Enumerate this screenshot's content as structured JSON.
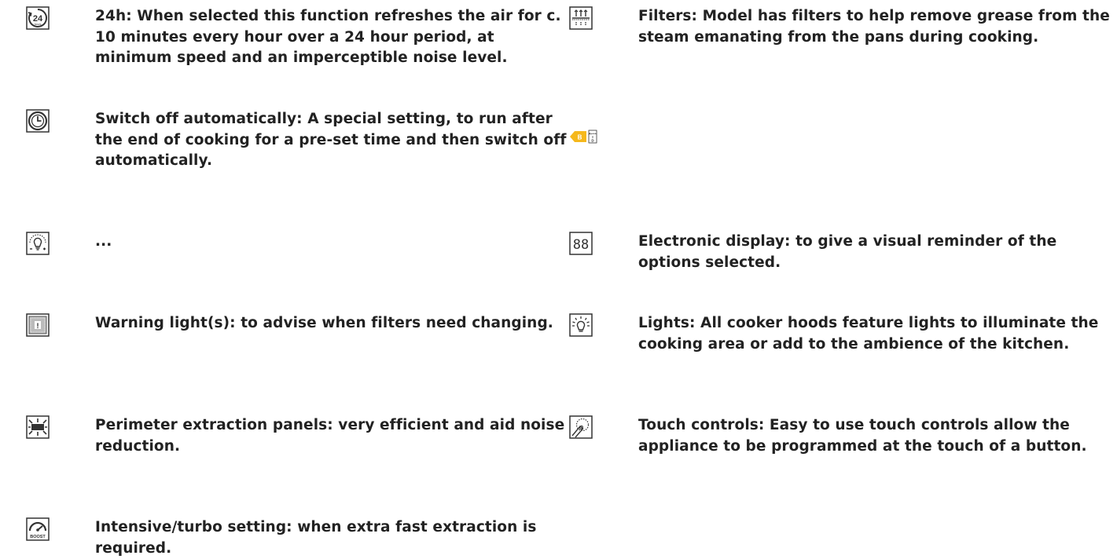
{
  "features": {
    "left": [
      {
        "icon": "24-hours-icon",
        "text": "24h: When selected this function refreshes the air for c. 10 minutes every hour over a 24 hour period, at minimum speed and an imperceptible noise level."
      },
      {
        "icon": "clock-icon",
        "text": "Switch off automatically: A special setting, to run after the end of cooking for a pre-set time and then switch off automatically."
      },
      {
        "icon": "dimmable-light-icon",
        "text": "..."
      },
      {
        "icon": "filter-warning-icon",
        "text": "Warning light(s): to advise when filters need changing."
      },
      {
        "icon": "perimeter-extraction-icon",
        "text": "Perimeter extraction panels: very efficient and aid noise reduction."
      },
      {
        "icon": "boost-icon",
        "icon_label": "BOOST",
        "text": "Intensive/turbo setting: when extra fast extraction is required."
      }
    ],
    "right": [
      {
        "icon": "grease-filter-icon",
        "text": "Filters: Model has filters to help remove grease from the steam emanating from the pans during cooking."
      },
      {
        "icon": "energy-class-icon",
        "icon_label": "B",
        "icon_scale": [
          "A+++",
          "D"
        ],
        "text": ""
      },
      {
        "icon": "digital-display-icon",
        "icon_label": "88",
        "text": "Electronic display: to give a visual reminder of the options selected."
      },
      {
        "icon": "light-bulb-icon",
        "text": "Lights: All cooker hoods feature lights to illuminate the cooking area or add to the ambience of the kitchen."
      },
      {
        "icon": "touch-control-icon",
        "text": "Touch controls: Easy to use touch controls allow the appliance to be programmed at the touch of a button."
      }
    ]
  },
  "colors": {
    "text": "#222222",
    "icon_stroke": "#333333",
    "energy_badge": "#f5b81c"
  }
}
